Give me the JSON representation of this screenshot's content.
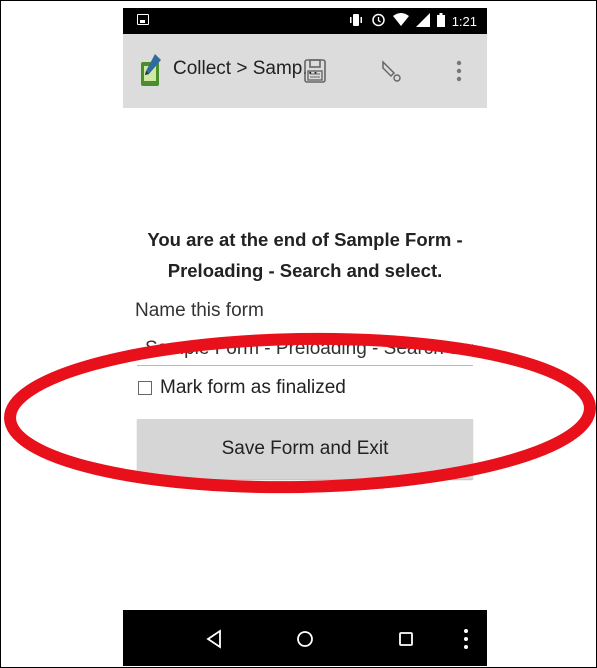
{
  "status_bar": {
    "time": "1:21",
    "icons": [
      "vibrate-icon",
      "alarm-icon",
      "wifi-icon",
      "signal-icon",
      "battery-icon"
    ]
  },
  "action_bar": {
    "title": "Collect > Samp...",
    "buttons": [
      "save-icon",
      "edit-icon",
      "overflow-menu-icon"
    ]
  },
  "content": {
    "heading": "You are at the end of Sample Form - Preloading - Search and select.",
    "name_label": "Name this form",
    "name_value": "Sample Form - Preloading - Search and select",
    "finalize_label": "Mark form as finalized",
    "finalize_checked": false,
    "save_button_label": "Save Form and Exit"
  },
  "navigation_bar": {
    "buttons": [
      "back-icon",
      "home-icon",
      "recents-icon",
      "more-icon"
    ]
  },
  "colors": {
    "annotation_ring": "#e8101a",
    "action_bar": "#dcdcdc",
    "button": "#d6d6d6"
  }
}
